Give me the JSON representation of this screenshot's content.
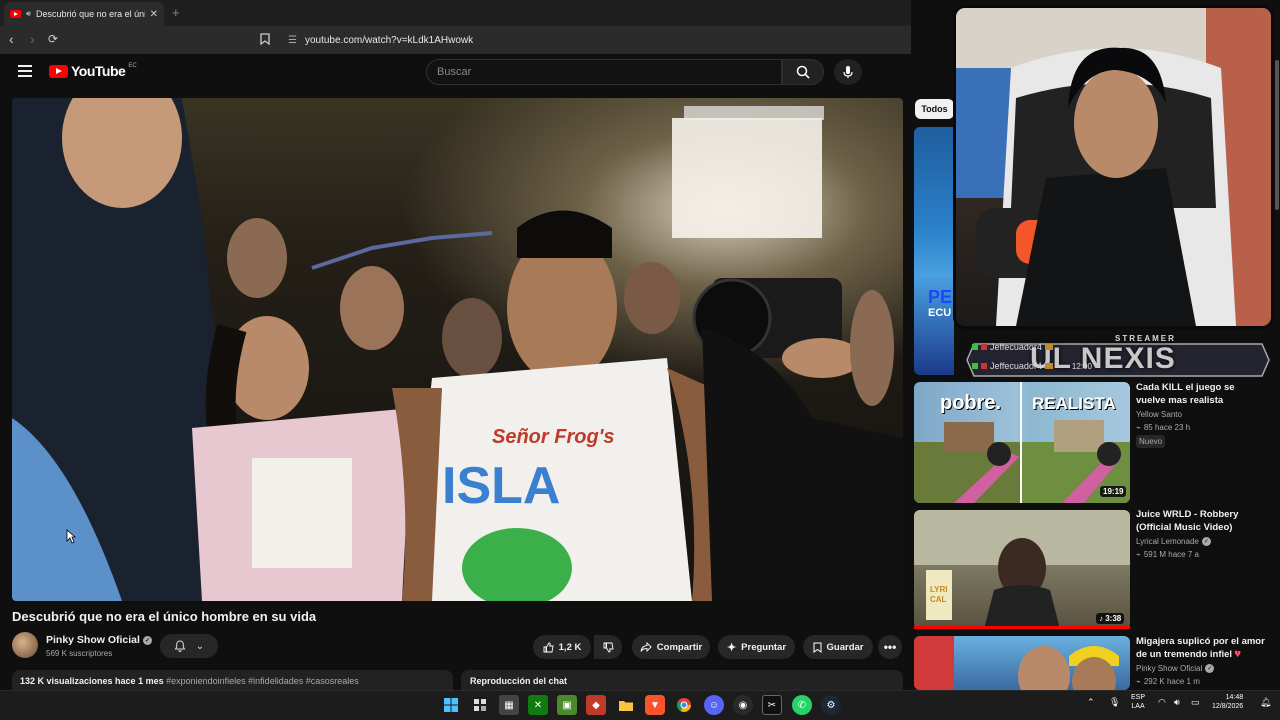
{
  "browser": {
    "tab_title": "Descubrió que no era el únic",
    "url": "youtube.com/watch?v=kLdk1AHwowk"
  },
  "youtube": {
    "logo_text": "YouTube",
    "country_code": "EC",
    "search_placeholder": "Buscar"
  },
  "video": {
    "title": "Descubrió que no era el único hombre en su vida",
    "channel": "Pinky Show Oficial",
    "subscribers": "569 K suscriptores",
    "likes": "1,2 K",
    "share_label": "Compartir",
    "ask_label": "Preguntar",
    "save_label": "Guardar",
    "views_date": "132 K visualizaciones  hace 1 mes",
    "tags": "#exponiendoinfieles #infidelidades #casosreales",
    "chat_label": "Reproducción del chat"
  },
  "sidebar": {
    "chip_all": "Todos",
    "overlay": {
      "streamer_label": "STREAMER",
      "streamer_name": "UL NEXIS",
      "feed": [
        "Jeffecuador4",
        "Jeffecuador4"
      ],
      "feed_score": "12:00"
    },
    "items": [
      {
        "title": "Cada KILL el juego se vuelve mas realista",
        "channel": "Yellow Santo",
        "meta": "85  hace 23 h",
        "badge": "Nuevo",
        "duration": "19:19",
        "thumb_left": "pobre.",
        "thumb_right": "REALISTA"
      },
      {
        "title": "Juice WRLD - Robbery (Official Music Video)",
        "channel": "Lyrical Lemonade",
        "meta": "591 M  hace 7 a",
        "duration": "3:38"
      },
      {
        "title": "Migajera suplicó por el amor de un tremendo infiel",
        "channel": "Pinky Show Oficial",
        "meta": "292 K  hace 1 m"
      }
    ],
    "strip_text_1": "PE",
    "strip_text_2": "ECU"
  },
  "taskbar": {
    "lang_1": "ESP",
    "lang_2": "LAA",
    "time": "14:48",
    "date": "12/8/2026"
  },
  "colors": {
    "accent": "#ff0000",
    "background": "#0f0f0f",
    "surface": "#272727",
    "text_secondary": "#aaaaaa"
  }
}
